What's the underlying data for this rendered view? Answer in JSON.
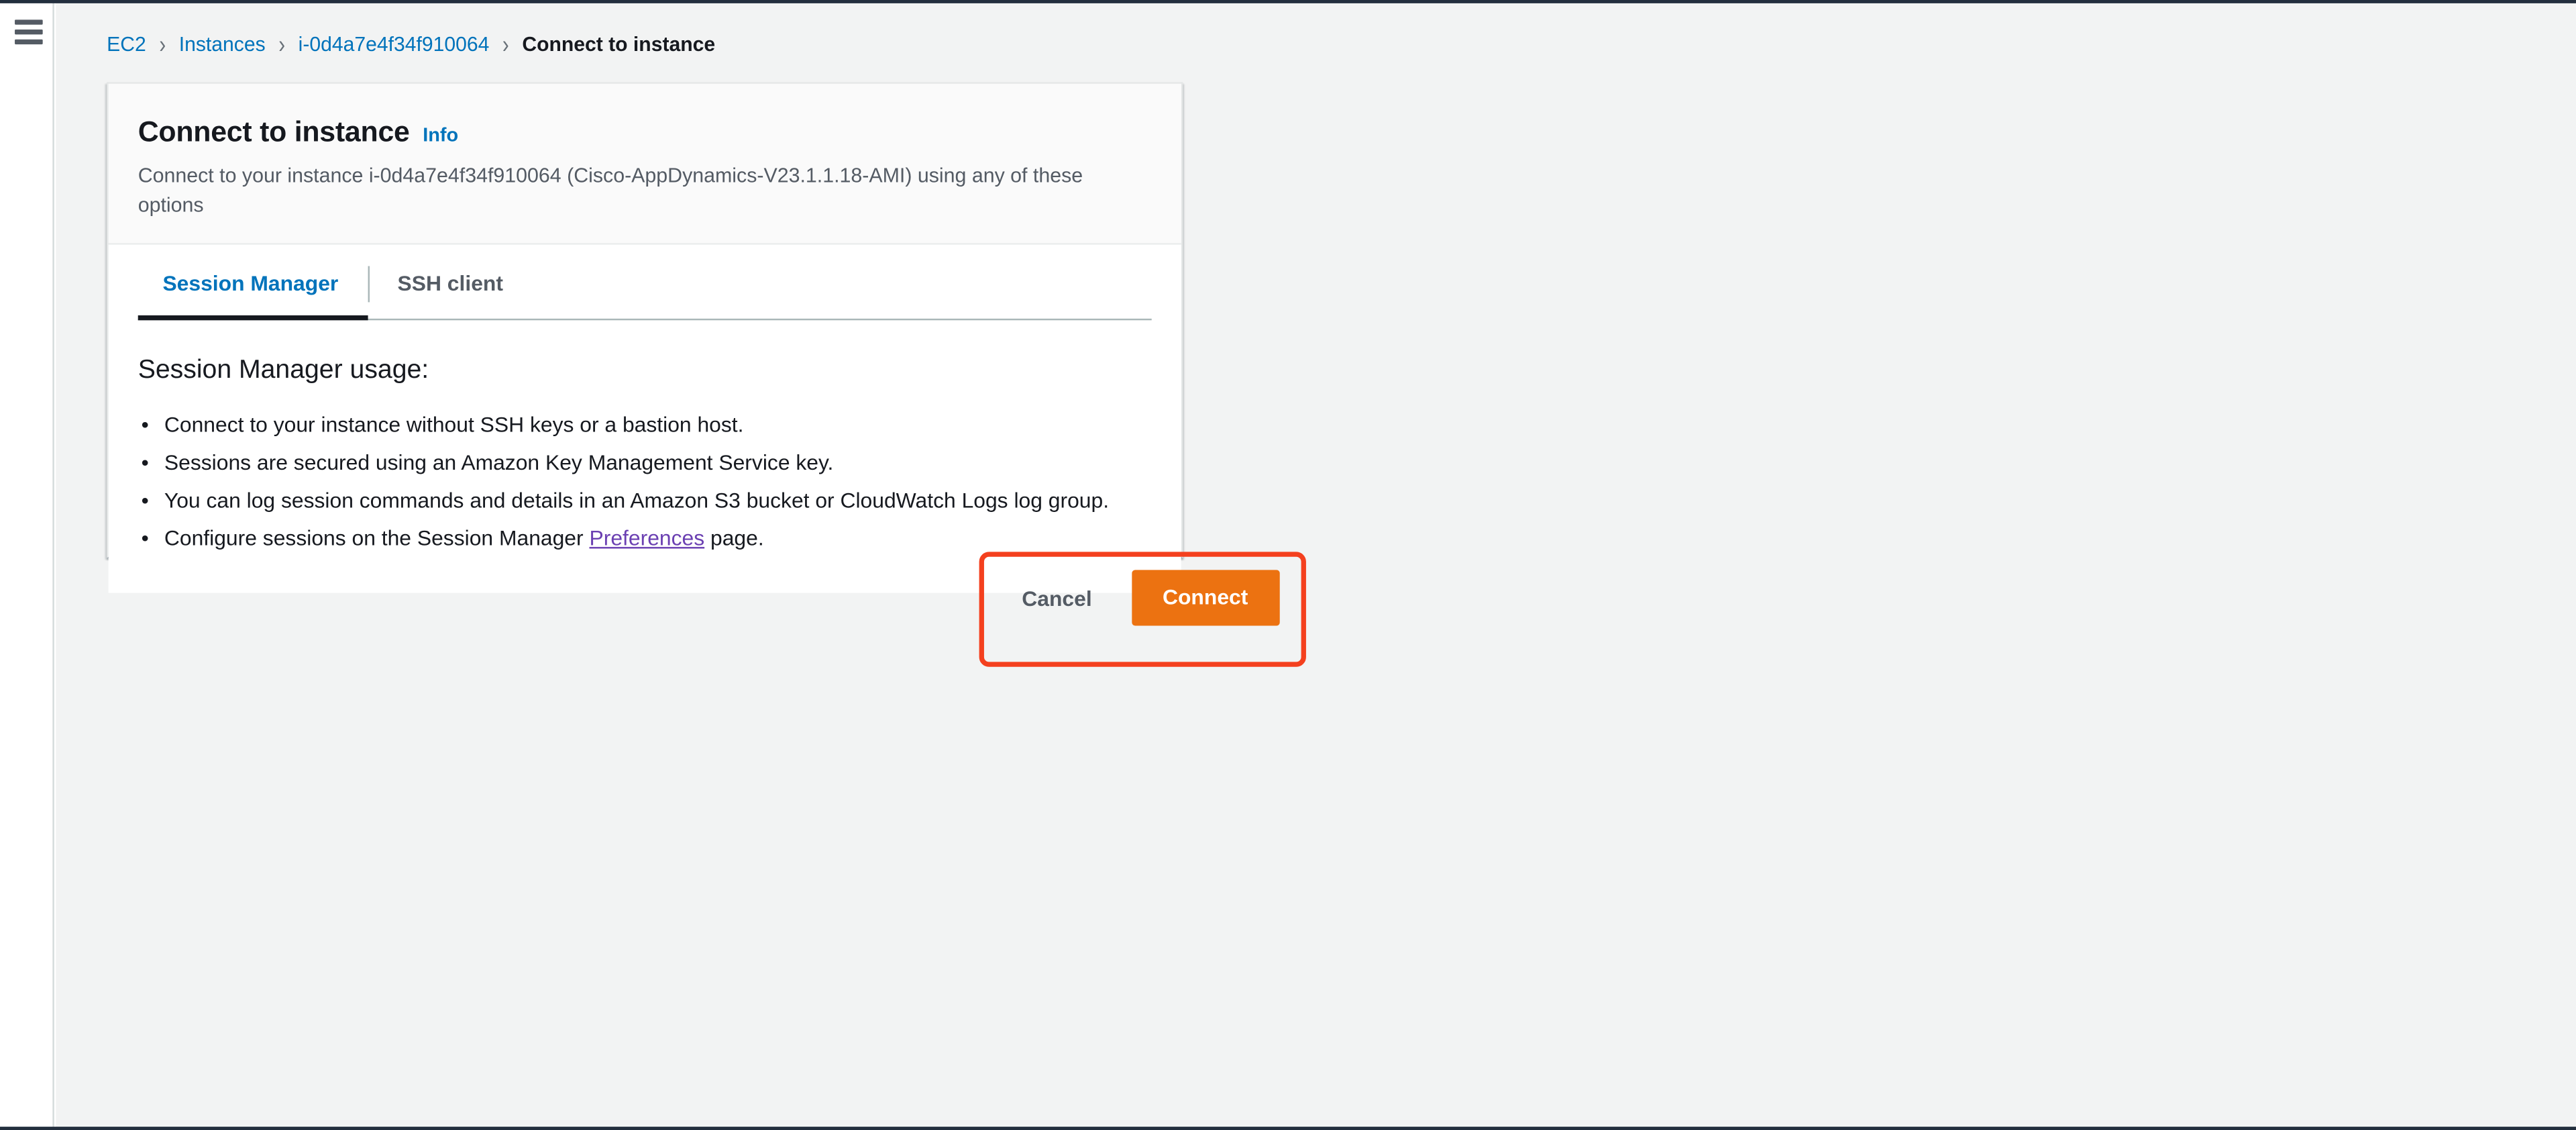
{
  "app": {
    "nav_toggle_label": "Open navigation menu"
  },
  "breadcrumb": {
    "items": [
      {
        "label": "EC2",
        "current": false
      },
      {
        "label": "Instances",
        "current": false
      },
      {
        "label": "i-0d4a7e4f34f910064",
        "current": false
      },
      {
        "label": "Connect to instance",
        "current": true
      }
    ],
    "separator": "›"
  },
  "card": {
    "title": "Connect to instance",
    "info_label": "Info",
    "description": "Connect to your instance i-0d4a7e4f34f910064 (Cisco-AppDynamics-V23.1.1.18-AMI) using any of these options",
    "instance_id": "i-0d4a7e4f34f910064",
    "ami_name": "Cisco-AppDynamics-V23.1.1.18-AMI"
  },
  "tabs": {
    "items": [
      {
        "label": "Session Manager",
        "active": true
      },
      {
        "label": "SSH client",
        "active": false
      }
    ]
  },
  "panel": {
    "heading": "Session Manager usage:",
    "bullets": [
      {
        "text": "Connect to your instance without SSH keys or a bastion host."
      },
      {
        "text": "Sessions are secured using an Amazon Key Management Service key."
      },
      {
        "text": "You can log session commands and details in an Amazon S3 bucket or CloudWatch Logs log group."
      }
    ],
    "last_bullet": {
      "prefix": "Configure sessions on the Session Manager ",
      "link": "Preferences",
      "suffix": " page."
    }
  },
  "footer": {
    "cancel_label": "Cancel",
    "connect_label": "Connect"
  },
  "colors": {
    "link_blue": "#0073bb",
    "visited_purple": "#6b40b2",
    "aws_orange": "#ec7211",
    "annotation_red": "#f4401e",
    "page_background": "#f2f3f3",
    "nav_dark": "#232f3e",
    "text_primary": "#16191f",
    "text_secondary": "#545b64"
  }
}
